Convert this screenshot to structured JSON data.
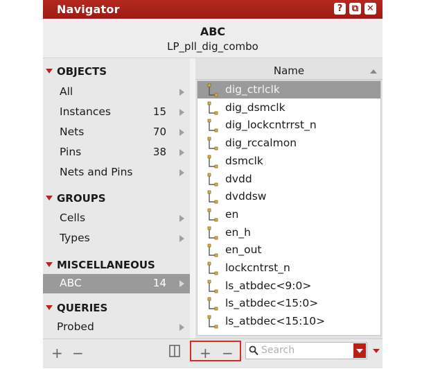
{
  "window": {
    "title": "Navigator",
    "buttons": [
      "?",
      "⧉",
      "✕"
    ]
  },
  "header": {
    "cell": "ABC",
    "subtitle": "LP_pll_dig_combo"
  },
  "sections": [
    {
      "title": "OBJECTS",
      "items": [
        {
          "label": "All",
          "count": ""
        },
        {
          "label": "Instances",
          "count": "15"
        },
        {
          "label": "Nets",
          "count": "70"
        },
        {
          "label": "Pins",
          "count": "38"
        },
        {
          "label": "Nets and Pins",
          "count": ""
        }
      ]
    },
    {
      "title": "GROUPS",
      "items": [
        {
          "label": "Cells",
          "count": ""
        },
        {
          "label": "Types",
          "count": ""
        }
      ]
    },
    {
      "title": "MISCELLANEOUS",
      "items": [
        {
          "label": "ABC",
          "count": "14",
          "selected": true
        }
      ]
    },
    {
      "title": "QUERIES",
      "items": [
        {
          "label": "Probed",
          "count": ""
        }
      ]
    }
  ],
  "list": {
    "column": "Name",
    "rows": [
      "dig_ctrlclk",
      "dig_dsmclk",
      "dig_lockcntrrst_n",
      "dig_rccalmon",
      "dsmclk",
      "dvdd",
      "dvddsw",
      "en",
      "en_h",
      "en_out",
      "lockcntrst_n",
      "ls_atbdec<9:0>",
      "ls_atbdec<15:0>",
      "ls_atbdec<15:10>"
    ],
    "selected_index": 0
  },
  "toolbar": {
    "add": "+",
    "remove": "−",
    "search_placeholder": "Search"
  },
  "colors": {
    "accent": "#b4281f",
    "selection": "#9a9a9a"
  }
}
